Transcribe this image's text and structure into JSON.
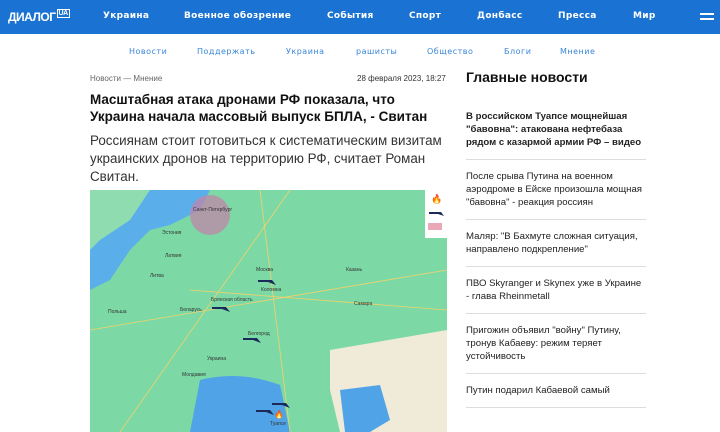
{
  "header": {
    "logo": "ДИАЛОГ",
    "logo_badge": "UA",
    "nav": [
      "Украина",
      "Военное обозрение",
      "События",
      "Спорт",
      "Донбасс",
      "Пресса",
      "Мир"
    ]
  },
  "subnav": [
    "Новости",
    "Поддержать",
    "Украина",
    "рашисты",
    "Общество",
    "Блоги",
    "Мнение"
  ],
  "article": {
    "breadcrumb": "Новости  —  Мнение",
    "date": "28 февраля 2023, 18:27",
    "title": "Масштабная атака дронами РФ показала, что Украина начала массовый выпуск БПЛА, - Свитан",
    "lead": "Россиянам стоит готовиться к систематическим визитам украинских дронов на территорию РФ, считает Роман Свитан.",
    "map_labels": [
      "Санкт-Петербург",
      "Москва",
      "Коломна",
      "Беларусь",
      "Брянская область",
      "Белгород",
      "Украина",
      "Туапсе",
      "Польша",
      "Эстония",
      "Латвия",
      "Литва",
      "Казань",
      "Самара",
      "Молдавия"
    ]
  },
  "sidebar": {
    "heading": "Главные новости",
    "items": [
      "В российском Туапсе мощнейшая \"бавовна\": атакована нефтебаза рядом с казармой армии РФ – видео",
      "После срыва Путина на военном аэродроме в Ейске произошла мощная \"бавовна\" - реакция россиян",
      "Маляр: \"В Бахмуте сложная ситуация, направлено подкрепление\"",
      "ПВО Skyranger и Skynex уже в Украине - глава Rheinmetall",
      "Пригожин объявил \"войну\" Путину, тронув Кабаеву: режим теряет устойчивость",
      "Путин подарил Кабаевой самый"
    ]
  }
}
